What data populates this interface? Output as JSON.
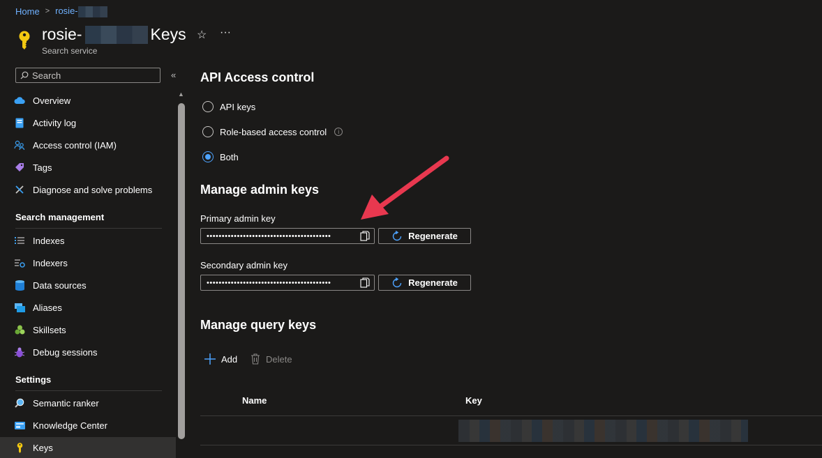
{
  "breadcrumb": {
    "home": "Home",
    "resource": "rosie-"
  },
  "header": {
    "title_prefix": "rosie-",
    "title_suffix": "Keys",
    "subtitle": "Search service",
    "favorite_icon": "star-icon",
    "more_label": "···"
  },
  "sidebar": {
    "search_placeholder": "Search",
    "collapse_label": "«",
    "top_items": [
      {
        "label": "Overview",
        "icon": "cloud-overview-icon"
      },
      {
        "label": "Activity log",
        "icon": "activity-log-icon"
      },
      {
        "label": "Access control (IAM)",
        "icon": "iam-people-icon"
      },
      {
        "label": "Tags",
        "icon": "tag-icon"
      },
      {
        "label": "Diagnose and solve problems",
        "icon": "wrench-icon"
      }
    ],
    "section_search_mgmt": "Search management",
    "search_items": [
      {
        "label": "Indexes",
        "icon": "list-icon"
      },
      {
        "label": "Indexers",
        "icon": "indexer-icon"
      },
      {
        "label": "Data sources",
        "icon": "database-icon"
      },
      {
        "label": "Aliases",
        "icon": "alias-icon"
      },
      {
        "label": "Skillsets",
        "icon": "skillset-icon"
      },
      {
        "label": "Debug sessions",
        "icon": "bug-icon"
      }
    ],
    "section_settings": "Settings",
    "settings_items": [
      {
        "label": "Semantic ranker",
        "icon": "magnifier-icon"
      },
      {
        "label": "Knowledge Center",
        "icon": "knowledge-icon"
      },
      {
        "label": "Keys",
        "icon": "key-icon",
        "active": true
      }
    ]
  },
  "main": {
    "api_access_title": "API Access control",
    "radio_options": [
      {
        "label": "API keys",
        "selected": false
      },
      {
        "label": "Role-based access control",
        "selected": false,
        "info": true
      },
      {
        "label": "Both",
        "selected": true
      }
    ],
    "admin_keys_title": "Manage admin keys",
    "primary_label": "Primary admin key",
    "primary_value": "•••••••••••••••••••••••••••••••••••••••••",
    "secondary_label": "Secondary admin key",
    "secondary_value": "•••••••••••••••••••••••••••••••••••••••••",
    "regenerate_label": "Regenerate",
    "query_keys_title": "Manage query keys",
    "add_label": "Add",
    "delete_label": "Delete",
    "columns": [
      "Name",
      "Key"
    ]
  },
  "colors": {
    "accent": "#4da3ff",
    "arrow": "#e8384f",
    "background": "#1b1a19"
  }
}
